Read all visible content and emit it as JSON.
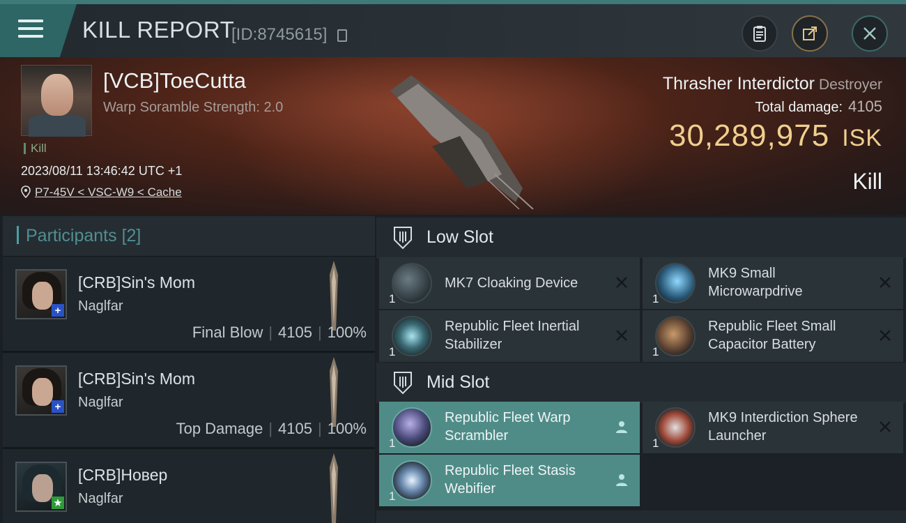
{
  "header": {
    "title": "KILL REPORT",
    "report_id": "[ID:8745615]"
  },
  "victim": {
    "name": "[VCB]ToeCutta",
    "sub": "Warp Soramble Strength: 2.0",
    "kill_tag": "Kill",
    "timestamp": "2023/08/11 13:46:42 UTC +1",
    "location": "P7-45V < VSC-W9 < Cache",
    "ship": "Thrasher Interdictor",
    "ship_class": "Destroyer",
    "total_damage_label": "Total damage:",
    "total_damage": "4105",
    "isk_value": "30,289,975",
    "isk_unit": "ISK",
    "result": "Kill"
  },
  "participants": {
    "title": "Participants",
    "count": "[2]",
    "rows": [
      {
        "name": "[CRB]Sin's Mom",
        "ship": "Naglfar",
        "role": "Final Blow",
        "damage": "4105",
        "percent": "100%",
        "badge": "+"
      },
      {
        "name": "[CRB]Sin's Mom",
        "ship": "Naglfar",
        "role": "Top Damage",
        "damage": "4105",
        "percent": "100%",
        "badge": "+"
      },
      {
        "name": "[CRB]Новер",
        "ship": "Naglfar",
        "role": "",
        "damage": "",
        "percent": "",
        "badge": "★"
      }
    ]
  },
  "fitting": {
    "low_slot": "Low Slot",
    "mid_slot": "Mid Slot",
    "low": [
      {
        "name": "MK7 Cloaking Device",
        "qty": "1",
        "state": "destroyed"
      },
      {
        "name": "MK9 Small Microwarpdrive",
        "qty": "1",
        "state": "destroyed"
      },
      {
        "name": "Republic Fleet Inertial Stabilizer",
        "qty": "1",
        "state": "destroyed"
      },
      {
        "name": "Republic Fleet Small Capacitor Battery",
        "qty": "1",
        "state": "destroyed"
      }
    ],
    "mid": [
      {
        "name": "Republic Fleet Warp Scrambler",
        "qty": "1",
        "state": "dropped"
      },
      {
        "name": "MK9 Interdiction Sphere Launcher",
        "qty": "1",
        "state": "destroyed"
      },
      {
        "name": "Republic Fleet Stasis Webifier",
        "qty": "1",
        "state": "dropped"
      }
    ]
  },
  "colors": {
    "accent_teal": "#4f8c88",
    "isk_gold": "#f0cf8e",
    "header_teal": "#2d6664"
  }
}
